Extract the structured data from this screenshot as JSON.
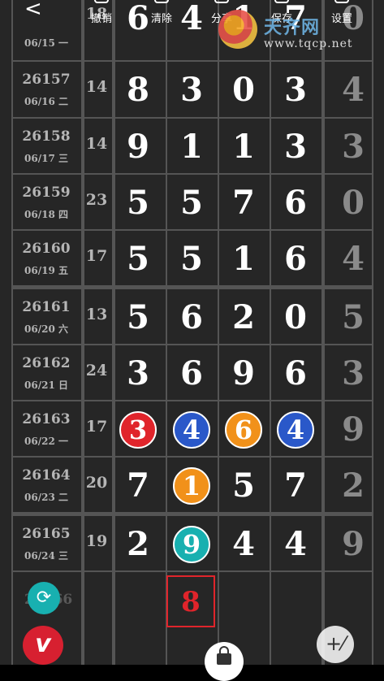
{
  "toolbar": {
    "back_glyph": "<",
    "items": [
      {
        "label": "撤销"
      },
      {
        "label": "清除"
      },
      {
        "label": "分享"
      },
      {
        "label": "保存"
      },
      {
        "label": "设置"
      }
    ]
  },
  "watermark": {
    "site_name": "天齐网",
    "url": "www.tqcp.net"
  },
  "top_partial_row": {
    "date": "06/15 一",
    "span": "18",
    "digits": [
      "6",
      "4",
      "1",
      "7",
      "0"
    ]
  },
  "rows": [
    {
      "issue": "26157",
      "date": "06/16 二",
      "span": "14",
      "digits": [
        "8",
        "3",
        "0",
        "3"
      ],
      "tail": "4",
      "balls": [
        null,
        null,
        null,
        null
      ]
    },
    {
      "issue": "26158",
      "date": "06/17 三",
      "span": "14",
      "digits": [
        "9",
        "1",
        "1",
        "3"
      ],
      "tail": "3",
      "balls": [
        null,
        null,
        null,
        null
      ]
    },
    {
      "issue": "26159",
      "date": "06/18 四",
      "span": "23",
      "digits": [
        "5",
        "5",
        "7",
        "6"
      ],
      "tail": "0",
      "balls": [
        null,
        null,
        null,
        null
      ]
    },
    {
      "issue": "26160",
      "date": "06/19 五",
      "span": "17",
      "digits": [
        "5",
        "5",
        "1",
        "6"
      ],
      "tail": "4",
      "balls": [
        null,
        null,
        null,
        null
      ]
    },
    {
      "issue": "26161",
      "date": "06/20 六",
      "span": "13",
      "digits": [
        "5",
        "6",
        "2",
        "0"
      ],
      "tail": "5",
      "balls": [
        null,
        null,
        null,
        null
      ]
    },
    {
      "issue": "26162",
      "date": "06/21 日",
      "span": "24",
      "digits": [
        "3",
        "6",
        "9",
        "6"
      ],
      "tail": "3",
      "balls": [
        null,
        null,
        null,
        null
      ]
    },
    {
      "issue": "26163",
      "date": "06/22 一",
      "span": "17",
      "digits": [
        "3",
        "4",
        "6",
        "4"
      ],
      "tail": "9",
      "balls": [
        "red",
        "blue",
        "orange",
        "blue"
      ]
    },
    {
      "issue": "26164",
      "date": "06/23 二",
      "span": "20",
      "digits": [
        "7",
        "1",
        "5",
        "7"
      ],
      "tail": "2",
      "balls": [
        null,
        "orange",
        null,
        null
      ]
    },
    {
      "issue": "26165",
      "date": "06/24 三",
      "span": "19",
      "digits": [
        "2",
        "9",
        "4",
        "4"
      ],
      "tail": "9",
      "balls": [
        null,
        "teal",
        null,
        null
      ]
    }
  ],
  "next_issue_partial": "26166",
  "prediction": {
    "value": "8"
  },
  "buttons": {
    "refresh_glyph": "⟳",
    "logo_glyph": "v",
    "draw_glyph": "+⁄"
  },
  "colors": {
    "background": "#262626",
    "grid": "#555555",
    "ball_red": "#e0242b",
    "ball_blue": "#2a58c9",
    "ball_orange": "#f1911a",
    "ball_teal": "#18b0b0",
    "prediction_border": "#e0242b"
  }
}
